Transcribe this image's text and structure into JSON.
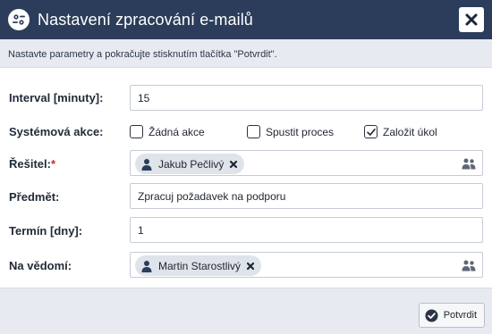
{
  "dialog": {
    "title": "Nastavení zpracování e-mailů",
    "title_icon": "settings-gear-icon",
    "close_icon": "close-icon",
    "info_text": "Nastavte parametry a pokračujte stisknutím tlačítka \"Potvrdit\"."
  },
  "form": {
    "interval": {
      "label": "Interval [minuty]:",
      "value": "15"
    },
    "system_action": {
      "label": "Systémová akce:",
      "options": [
        {
          "label": "Žádná akce",
          "checked": false
        },
        {
          "label": "Spustit proces",
          "checked": false
        },
        {
          "label": "Založit úkol",
          "checked": true
        }
      ]
    },
    "solver": {
      "label": "Řešitel:",
      "required_mark": "*",
      "tag": "Jakub Pečlivý",
      "picker_icon": "users-icon"
    },
    "subject": {
      "label": "Předmět:",
      "value": "Zpracuj požadavek na podporu"
    },
    "deadline": {
      "label": "Termín [dny]:",
      "value": "1"
    },
    "cc": {
      "label": "Na vědomí:",
      "tag": "Martin Starostlivý",
      "picker_icon": "users-icon"
    }
  },
  "footer": {
    "confirm_label": "Potvrdit",
    "confirm_icon": "check-circle-icon"
  },
  "colors": {
    "titlebar": "#2b3d5b",
    "info_bar": "#e7ebf1",
    "required": "#d42a2a"
  }
}
